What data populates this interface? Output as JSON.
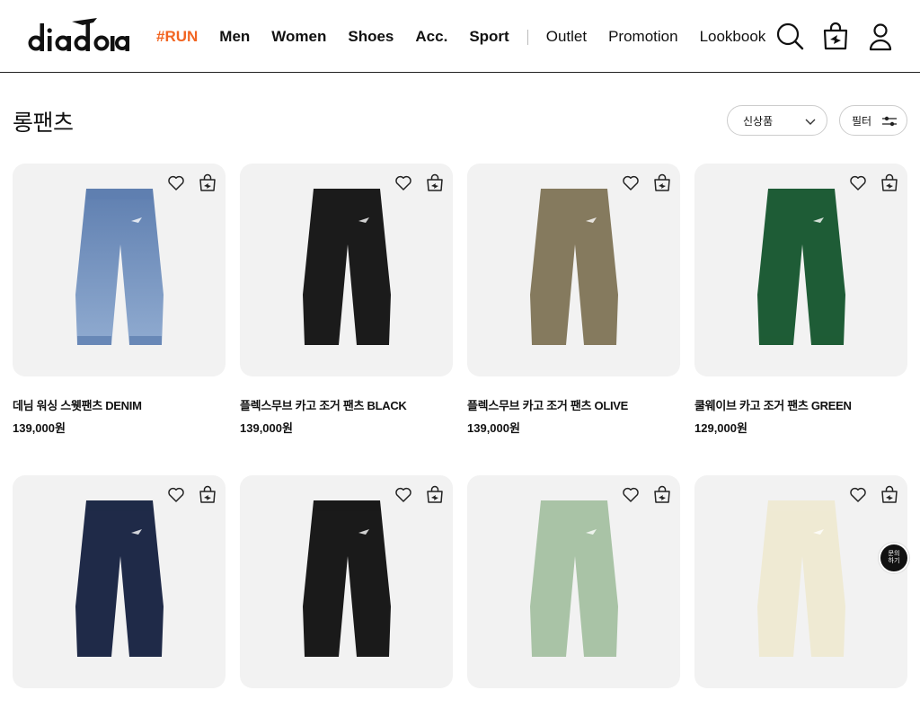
{
  "brand": {
    "logo_text": "diadora"
  },
  "nav": {
    "primary": [
      {
        "label": "#RUN",
        "highlight": true
      },
      {
        "label": "Men"
      },
      {
        "label": "Women"
      },
      {
        "label": "Shoes"
      },
      {
        "label": "Acc."
      },
      {
        "label": "Sport"
      }
    ],
    "secondary": [
      {
        "label": "Outlet"
      },
      {
        "label": "Promotion"
      },
      {
        "label": "Lookbook"
      }
    ],
    "icons": [
      "search-icon",
      "shopping-bag-icon",
      "user-icon"
    ]
  },
  "page": {
    "title": "롱팬츠"
  },
  "controls": {
    "sort_label": "신상품",
    "filter_label": "필터"
  },
  "products": [
    {
      "name": "데님 워싱 스웻팬츠 DENIM",
      "price": "139,000원",
      "color": "#5f7fb0",
      "color2": "#90abd0"
    },
    {
      "name": "플렉스무브 카고 조거 팬츠 BLACK",
      "price": "139,000원",
      "color": "#1b1b1b",
      "color2": "#1b1b1b"
    },
    {
      "name": "플렉스무브 카고 조거 팬츠 OLIVE",
      "price": "139,000원",
      "color": "#857a5e",
      "color2": "#857a5e"
    },
    {
      "name": "쿨웨이브 카고 조거 팬츠 GREEN",
      "price": "129,000원",
      "color": "#1e5c36",
      "color2": "#1e5c36"
    },
    {
      "name": "",
      "price": "",
      "color": "#1f2a48",
      "color2": "#1f2a48"
    },
    {
      "name": "",
      "price": "",
      "color": "#1a1a1a",
      "color2": "#1a1a1a"
    },
    {
      "name": "",
      "price": "",
      "color": "#a9c3a6",
      "color2": "#a9c3a6"
    },
    {
      "name": "",
      "price": "",
      "color": "#efead3",
      "color2": "#efead3"
    }
  ],
  "chat": {
    "label_line1": "문의",
    "label_line2": "하기"
  },
  "colors": {
    "accent": "#f26522",
    "card_bg": "#f2f2f2"
  }
}
